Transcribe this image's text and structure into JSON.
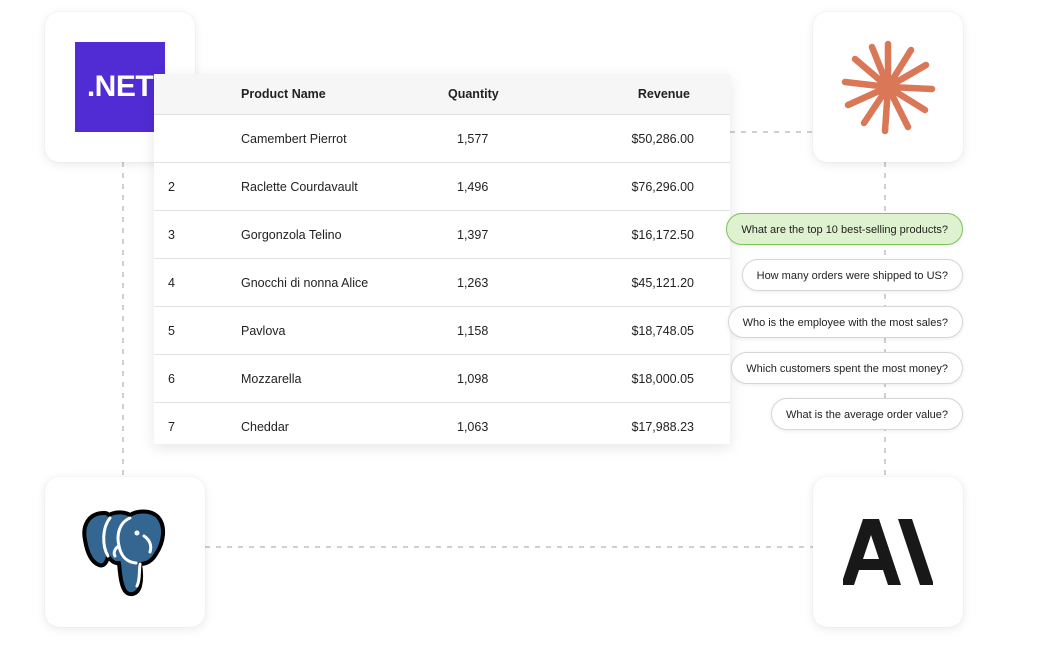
{
  "table": {
    "headers": {
      "rank": "",
      "product": "Product Name",
      "quantity": "Quantity",
      "revenue": "Revenue"
    },
    "rows": [
      {
        "rank": "",
        "product": "Camembert Pierrot",
        "quantity": "1,577",
        "revenue": "$50,286.00"
      },
      {
        "rank": "2",
        "product": "Raclette Courdavault",
        "quantity": "1,496",
        "revenue": "$76,296.00"
      },
      {
        "rank": "3",
        "product": "Gorgonzola Telino",
        "quantity": "1,397",
        "revenue": "$16,172.50"
      },
      {
        "rank": "4",
        "product": "Gnocchi di nonna Alice",
        "quantity": "1,263",
        "revenue": "$45,121.20"
      },
      {
        "rank": "5",
        "product": "Pavlova",
        "quantity": "1,158",
        "revenue": "$18,748.05"
      },
      {
        "rank": "6",
        "product": "Mozzarella",
        "quantity": "1,098",
        "revenue": "$18,000.05"
      },
      {
        "rank": "7",
        "product": "Cheddar",
        "quantity": "1,063",
        "revenue": "$17,988.23"
      }
    ]
  },
  "logos": {
    "dotnet": ".NET",
    "dotnet_color": "#512bd4",
    "claude_icon": "claude-spark-icon",
    "claude_color": "#d97757",
    "postgres_icon": "postgresql-elephant-icon",
    "postgres_color": "#336791",
    "anthropic_icon": "anthropic-ai-icon"
  },
  "questions": [
    {
      "text": "What are the top 10 best-selling products?",
      "active": true
    },
    {
      "text": "How many orders were shipped to US?",
      "active": false
    },
    {
      "text": "Who is the employee with the most sales?",
      "active": false
    },
    {
      "text": "Which customers spent the most money?",
      "active": false
    },
    {
      "text": "What is the average order value?",
      "active": false
    }
  ]
}
